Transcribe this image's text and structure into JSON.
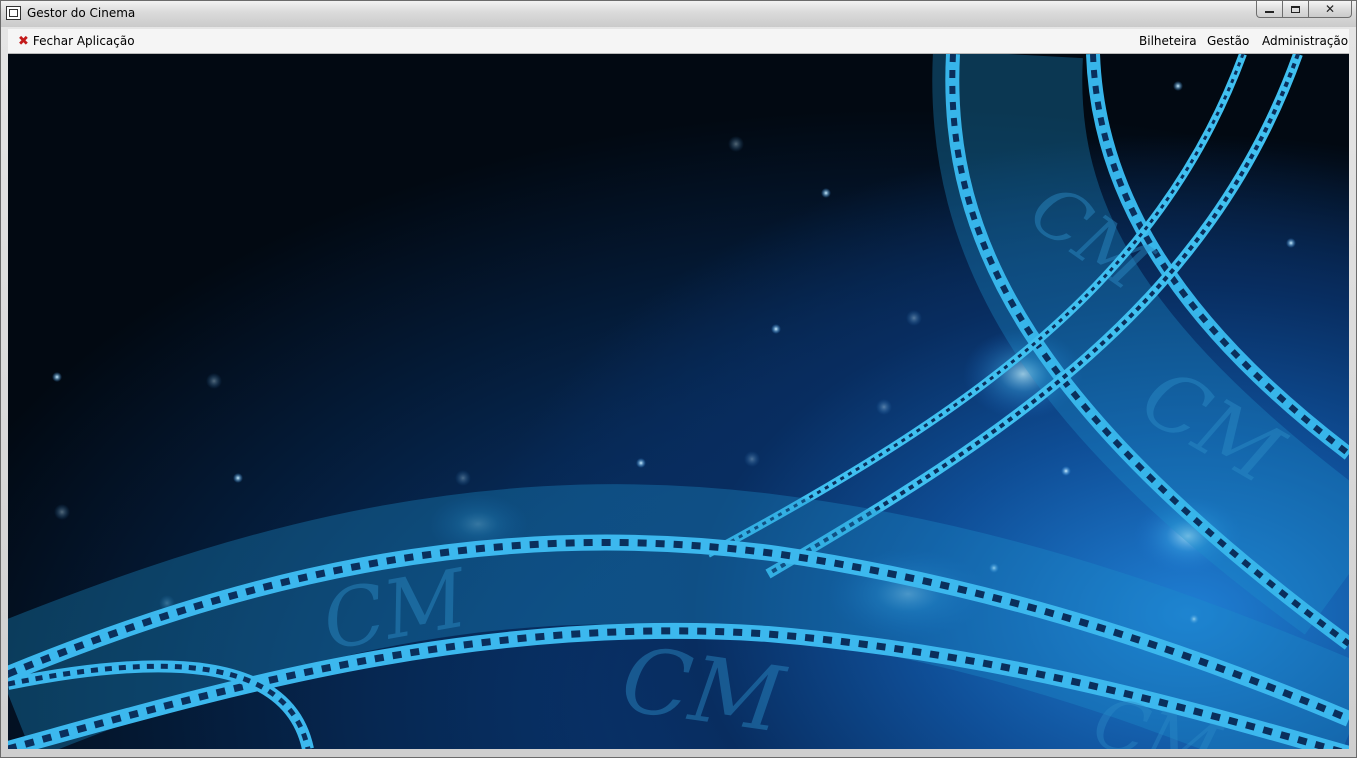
{
  "window": {
    "title": "Gestor do Cinema",
    "buttons": [
      "minimize-icon",
      "maximize-icon",
      "close-icon"
    ]
  },
  "menubar": {
    "close_app": {
      "label": "Fechar Aplicação",
      "icon": "red-x-icon"
    },
    "items": [
      {
        "label": "Bilheteira"
      },
      {
        "label": "Gestão"
      },
      {
        "label": "Administração"
      }
    ]
  },
  "background": {
    "description_colors": {
      "dark": "#020912",
      "mid": "#0a3f85",
      "highlight": "#29b6f0"
    }
  }
}
